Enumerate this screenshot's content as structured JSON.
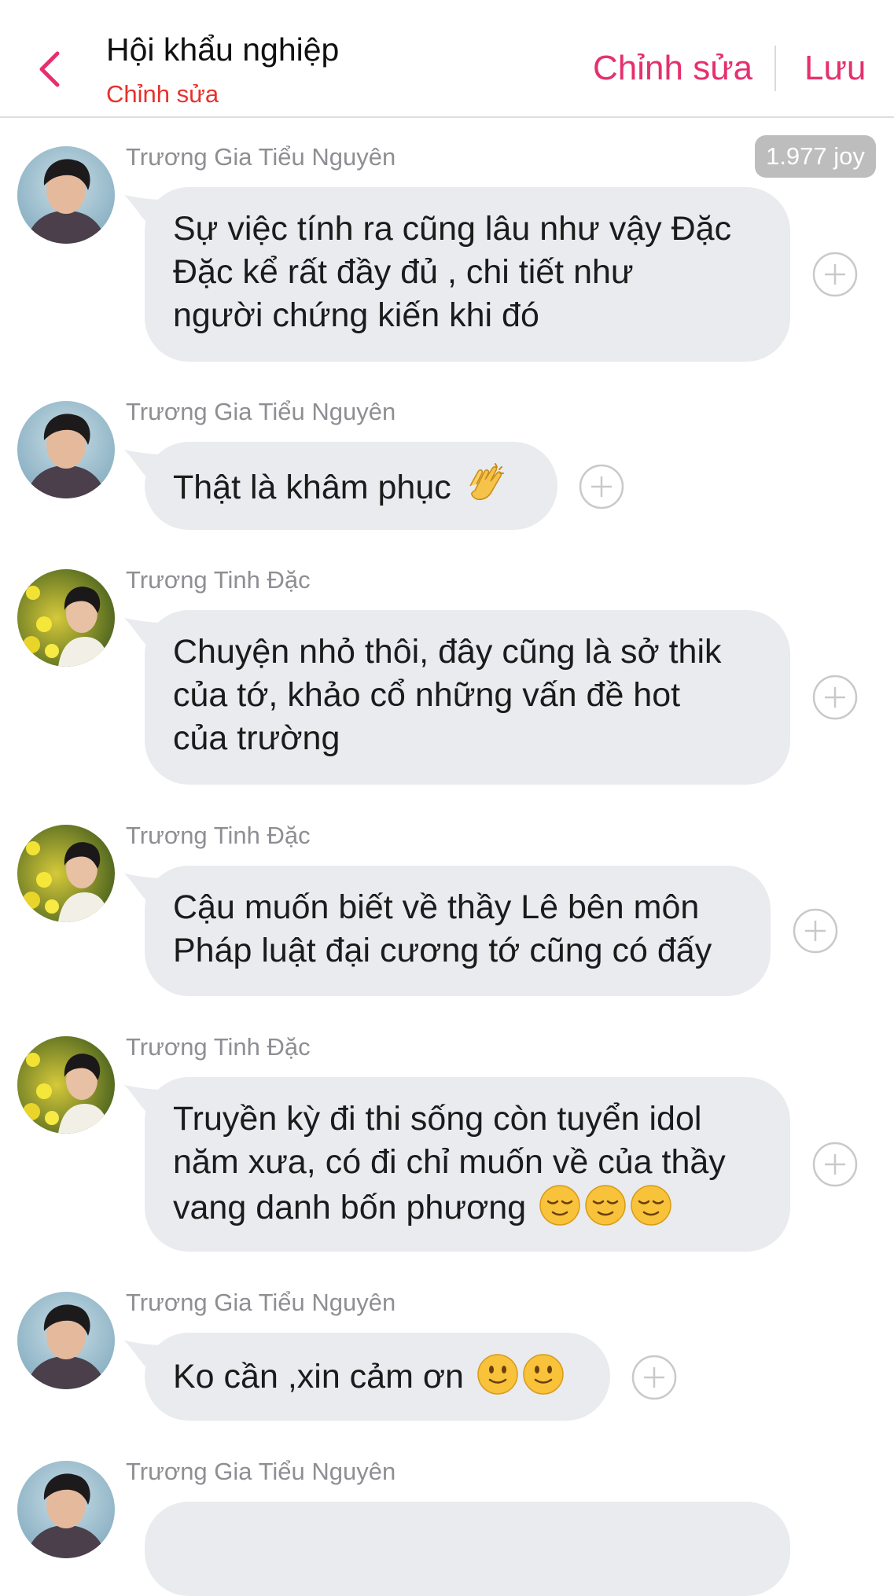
{
  "header": {
    "title": "Hội khẩu nghiệp",
    "subtitle": "Chỉnh sửa",
    "edit_label": "Chỉnh sửa",
    "save_label": "Lưu"
  },
  "badge": {
    "joy": "1.977 joy"
  },
  "colors": {
    "accent": "#e5306f",
    "subtitle": "#e8312d",
    "bubble": "#e9ebee"
  },
  "messages": [
    {
      "sender": "Trương Gia Tiểu Nguyên",
      "lines": [
        "Sự việc tính ra cũng lâu như vậy Đặc",
        "Đặc kể rất đầy đủ , chi tiết như",
        "người chứng kiến khi đó"
      ],
      "emoji": []
    },
    {
      "sender": "Trương Gia Tiểu Nguyên",
      "lines": [
        "Thật là khâm phục"
      ],
      "emoji": [
        "clapping-hands"
      ]
    },
    {
      "sender": "Trương Tinh Đặc",
      "lines": [
        "Chuyện nhỏ thôi, đây cũng là sở thik",
        "của tớ, khảo cổ những vấn đề hot",
        "của trường"
      ],
      "emoji": []
    },
    {
      "sender": "Trương Tinh Đặc",
      "lines": [
        "Cậu muốn biết về thầy Lê bên môn",
        "Pháp luật đại cương tớ cũng có đấy"
      ],
      "emoji": []
    },
    {
      "sender": "Trương Tinh Đặc",
      "lines": [
        "Truyền kỳ đi thi sống còn tuyển idol",
        "năm xưa, có đi chỉ muốn về của thầy",
        "vang danh bốn phương"
      ],
      "emoji": [
        "relieved-face",
        "relieved-face",
        "relieved-face"
      ]
    },
    {
      "sender": "Trương Gia Tiểu Nguyên",
      "lines": [
        "Ko cần ,xin cảm ơn"
      ],
      "emoji": [
        "slight-smile",
        "slight-smile"
      ]
    },
    {
      "sender": "Trương Gia Tiểu Nguyên",
      "lines": [],
      "emoji": []
    }
  ]
}
